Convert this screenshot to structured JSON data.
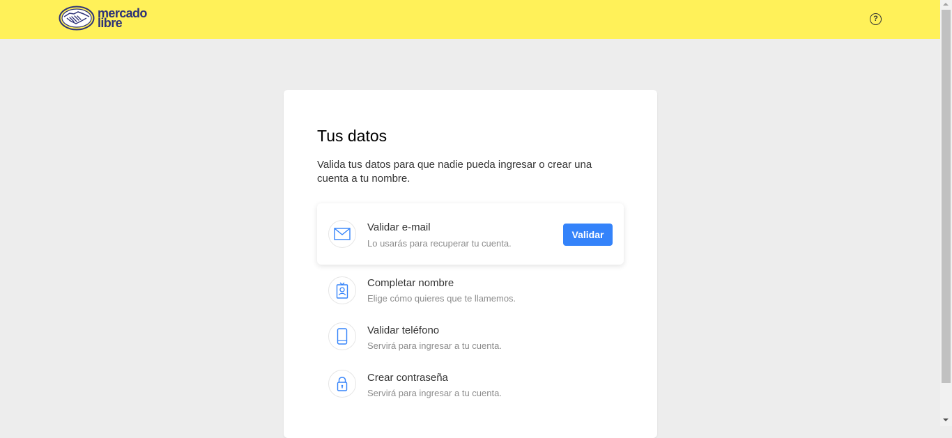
{
  "header": {
    "logo_line1": "mercado",
    "logo_line2": "libre",
    "help_symbol": "?",
    "brand_color": "#fff159",
    "logo_color": "#2d3277"
  },
  "card": {
    "title": "Tus datos",
    "description": "Valida tus datos para que nadie pueda ingresar o crear una cuenta a tu nombre.",
    "tasks": [
      {
        "icon": "envelope-icon",
        "title": "Validar e-mail",
        "subtitle": "Lo usarás para recuperar tu cuenta.",
        "button_label": "Validar",
        "active": true
      },
      {
        "icon": "id-badge-icon",
        "title": "Completar nombre",
        "subtitle": "Elige cómo quieres que te llamemos.",
        "active": false
      },
      {
        "icon": "phone-icon",
        "title": "Validar teléfono",
        "subtitle": "Servirá para ingresar a tu cuenta.",
        "active": false
      },
      {
        "icon": "lock-icon",
        "title": "Crear contraseña",
        "subtitle": "Servirá para ingresar a tu cuenta.",
        "active": false
      }
    ]
  },
  "colors": {
    "accent": "#3483fa",
    "background": "#ededed"
  }
}
